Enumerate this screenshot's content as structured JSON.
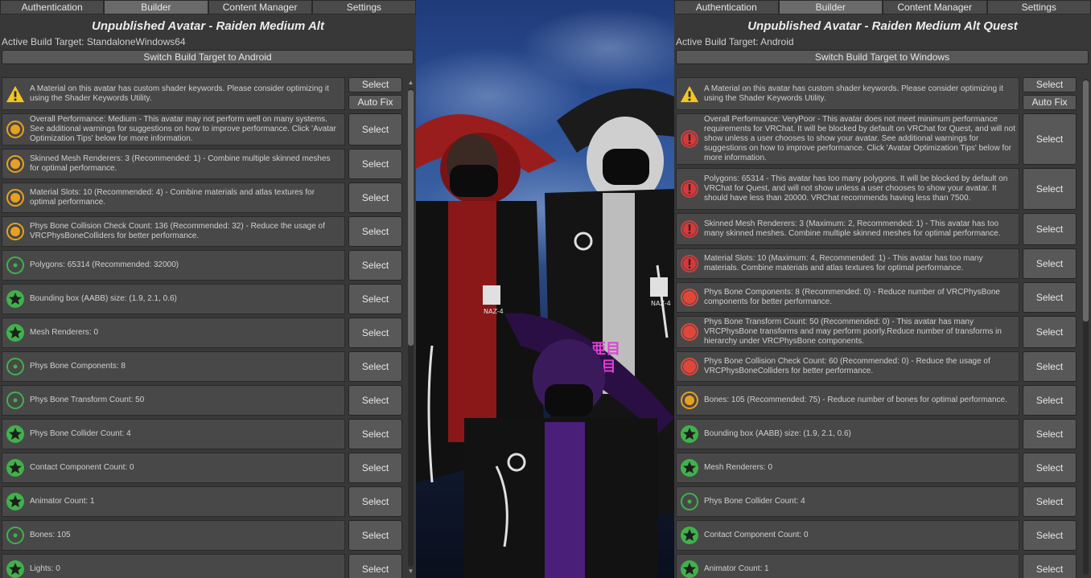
{
  "left": {
    "tabs": [
      "Authentication",
      "Builder",
      "Content Manager",
      "Settings"
    ],
    "active_tab": 1,
    "title": "Unpublished Avatar - Raiden Medium Alt",
    "build_target": "Active Build Target: StandaloneWindows64",
    "switch_label": "Switch Build Target to Android",
    "rows": [
      {
        "icon": "warning",
        "text": "A Material on this avatar has custom shader keywords. Please consider optimizing it using the Shader Keywords Utility.",
        "buttons": [
          "Select",
          "Auto Fix"
        ],
        "h": 41
      },
      {
        "icon": "medium",
        "text": "Overall Performance: Medium - This avatar may not perform well on many systems. See additional warnings for suggestions on how to improve performance. Click 'Avatar Optimization Tips' below for more information.",
        "buttons": [
          "Select"
        ],
        "h": 40
      },
      {
        "icon": "medium",
        "text": "Skinned Mesh Renderers: 3 (Recommended: 1) - Combine multiple skinned meshes for optimal performance.",
        "buttons": [
          "Select"
        ],
        "h": 38
      },
      {
        "icon": "medium",
        "text": "Material Slots: 10 (Recommended: 4) - Combine materials and atlas textures for optimal performance.",
        "buttons": [
          "Select"
        ],
        "h": 38
      },
      {
        "icon": "medium",
        "text": "Phys Bone Collision Check Count: 136 (Recommended: 32) - Reduce the usage of VRCPhysBoneColliders for better performance.",
        "buttons": [
          "Select"
        ],
        "h": 38
      },
      {
        "icon": "good",
        "text": "Polygons: 65314 (Recommended: 32000)",
        "buttons": [
          "Select"
        ],
        "h": 38
      },
      {
        "icon": "excellent",
        "text": "Bounding box (AABB) size: (1.9, 2.1, 0.6)",
        "buttons": [
          "Select"
        ],
        "h": 38
      },
      {
        "icon": "excellent",
        "text": "Mesh Renderers: 0",
        "buttons": [
          "Select"
        ],
        "h": 38
      },
      {
        "icon": "good",
        "text": "Phys Bone Components: 8",
        "buttons": [
          "Select"
        ],
        "h": 38
      },
      {
        "icon": "good",
        "text": "Phys Bone Transform Count: 50",
        "buttons": [
          "Select"
        ],
        "h": 38
      },
      {
        "icon": "excellent",
        "text": "Phys Bone Collider Count: 4",
        "buttons": [
          "Select"
        ],
        "h": 38
      },
      {
        "icon": "excellent",
        "text": "Contact Component Count: 0",
        "buttons": [
          "Select"
        ],
        "h": 38
      },
      {
        "icon": "excellent",
        "text": "Animator Count: 1",
        "buttons": [
          "Select"
        ],
        "h": 38
      },
      {
        "icon": "good",
        "text": "Bones: 105",
        "buttons": [
          "Select"
        ],
        "h": 38
      },
      {
        "icon": "excellent",
        "text": "Lights: 0",
        "buttons": [
          "Select"
        ],
        "h": 38
      }
    ]
  },
  "right": {
    "tabs": [
      "Authentication",
      "Builder",
      "Content Manager",
      "Settings"
    ],
    "active_tab": 1,
    "title": "Unpublished Avatar - Raiden Medium Alt Quest",
    "build_target": "Active Build Target: Android",
    "switch_label": "Switch Build Target to Windows",
    "rows": [
      {
        "icon": "warning",
        "text": "A Material on this avatar has custom shader keywords. Please consider optimizing it using the Shader Keywords Utility.",
        "buttons": [
          "Select",
          "Auto Fix"
        ],
        "h": 41
      },
      {
        "icon": "verypoor",
        "text": "Overall Performance: VeryPoor - This avatar does not meet minimum performance requirements for VRChat. It will be blocked by default on VRChat for Quest, and will not show unless a user chooses to show your avatar. See additional warnings for suggestions on how to improve performance. Click 'Avatar Optimization Tips' below for more information.",
        "buttons": [
          "Select"
        ],
        "h": 64
      },
      {
        "icon": "verypoor",
        "text": "Polygons: 65314 - This avatar has too many polygons. It will be blocked by default on VRChat for Quest, and will not show unless a user chooses to show your avatar. It should have less than 20000. VRChat recommends having less than 7500.",
        "buttons": [
          "Select"
        ],
        "h": 52
      },
      {
        "icon": "verypoor",
        "text": "Skinned Mesh Renderers: 3 (Maximum: 2, Recommended: 1) - This avatar has too many skinned meshes. Combine multiple skinned meshes for optimal performance.",
        "buttons": [
          "Select"
        ],
        "h": 40
      },
      {
        "icon": "verypoor",
        "text": "Material Slots: 10 (Maximum: 4, Recommended: 1) - This avatar has too many materials. Combine materials and atlas textures for optimal performance.",
        "buttons": [
          "Select"
        ],
        "h": 38
      },
      {
        "icon": "poor",
        "text": "Phys Bone Components: 8 (Recommended: 0) - Reduce number of VRCPhysBone components for better performance.",
        "buttons": [
          "Select"
        ],
        "h": 38
      },
      {
        "icon": "poor",
        "text": "Phys Bone Transform Count: 50 (Recommended: 0) - This avatar has many VRCPhysBone transforms and may perform poorly.Reduce number of transforms in hierarchy under VRCPhysBone components.",
        "buttons": [
          "Select"
        ],
        "h": 40
      },
      {
        "icon": "poor",
        "text": "Phys Bone Collision Check Count: 60 (Recommended: 0) - Reduce the usage of VRCPhysBoneColliders for better performance.",
        "buttons": [
          "Select"
        ],
        "h": 38
      },
      {
        "icon": "medium",
        "text": "Bones: 105 (Recommended: 75) - Reduce number of bones for optimal performance.",
        "buttons": [
          "Select"
        ],
        "h": 38
      },
      {
        "icon": "excellent",
        "text": "Bounding box (AABB) size: (1.9, 2.1, 0.6)",
        "buttons": [
          "Select"
        ],
        "h": 38
      },
      {
        "icon": "excellent",
        "text": "Mesh Renderers: 0",
        "buttons": [
          "Select"
        ],
        "h": 38
      },
      {
        "icon": "good",
        "text": "Phys Bone Collider Count: 4",
        "buttons": [
          "Select"
        ],
        "h": 38
      },
      {
        "icon": "excellent",
        "text": "Contact Component Count: 0",
        "buttons": [
          "Select"
        ],
        "h": 38
      },
      {
        "icon": "excellent",
        "text": "Animator Count: 1",
        "buttons": [
          "Select"
        ],
        "h": 38
      }
    ]
  },
  "viewport": {
    "hat_badge_text": "亜目\n5目",
    "shirt_text": "NAZ-4"
  },
  "colors": {
    "warning": "#f3c522",
    "medium": "#e8a020",
    "good": "#3fb24a",
    "excellent": "#3fb24a",
    "poor": "#e0473b",
    "verypoor": "#d8383a",
    "sky_top": "#1f3a78"
  }
}
